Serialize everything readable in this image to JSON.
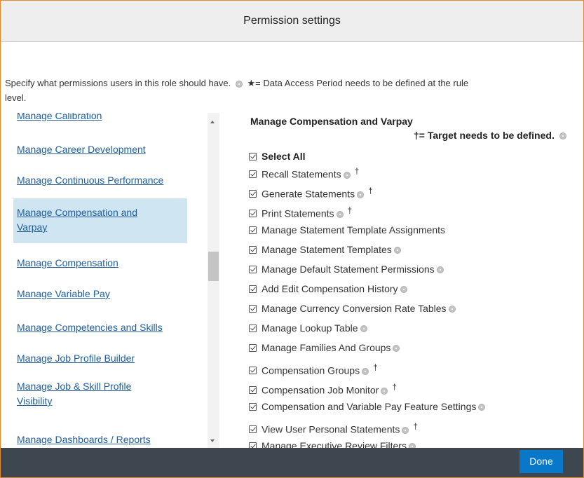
{
  "dialog": {
    "title": "Permission settings",
    "description_line1_a": "Specify what permissions users in this role should have.",
    "description_line1_b": "★= Data Access Period needs to be defined at the rule",
    "description_line2": "level."
  },
  "sidebar": {
    "items": [
      {
        "label": "Manage Calibration"
      },
      {
        "label": "Manage Career Development"
      },
      {
        "label": "Manage Continuous Performance"
      },
      {
        "label_line1": "Manage Compensation and",
        "label_line2": "Varpay",
        "selected": true
      },
      {
        "label": "Manage Compensation"
      },
      {
        "label": "Manage Variable Pay"
      },
      {
        "label": "Manage Competencies and Skills"
      },
      {
        "label": "Manage Job Profile Builder"
      },
      {
        "label_line1": "Manage Job & Skill Profile",
        "label_line2": "Visibility"
      },
      {
        "label": "Manage Dashboards / Reports"
      }
    ]
  },
  "permissions": {
    "section_title": "Manage Compensation and Varpay",
    "target_note": "†= Target needs to be defined.",
    "select_all": "Select All",
    "items": [
      {
        "label": "Recall Statements",
        "dagger": "†"
      },
      {
        "label": "Generate Statements",
        "dagger": "†"
      },
      {
        "label": "Print Statements",
        "dagger": "†"
      },
      {
        "label": "Manage Statement Template Assignments"
      },
      {
        "label": "Manage Statement Templates"
      },
      {
        "label": "Manage Default Statement Permissions"
      },
      {
        "label": "Add Edit Compensation History"
      },
      {
        "label": "Manage Currency Conversion Rate Tables"
      },
      {
        "label": "Manage Lookup Table"
      },
      {
        "label": "Manage Families And Groups"
      },
      {
        "label": "Compensation Groups",
        "dagger": "†"
      },
      {
        "label": "Compensation Job Monitor",
        "dagger": "†"
      },
      {
        "label": "Compensation and Variable Pay Feature Settings"
      },
      {
        "label": "View User Personal Statements",
        "dagger": "†"
      },
      {
        "label": "Manage Executive Review Filters"
      }
    ]
  },
  "footer": {
    "done_label": "Done"
  },
  "colors": {
    "accent_border": "#e2882f",
    "link": "#1f5d99",
    "selected_bg": "#cfe6f2",
    "footer_bg": "#3e464f",
    "done_bg": "#0a78c8"
  }
}
